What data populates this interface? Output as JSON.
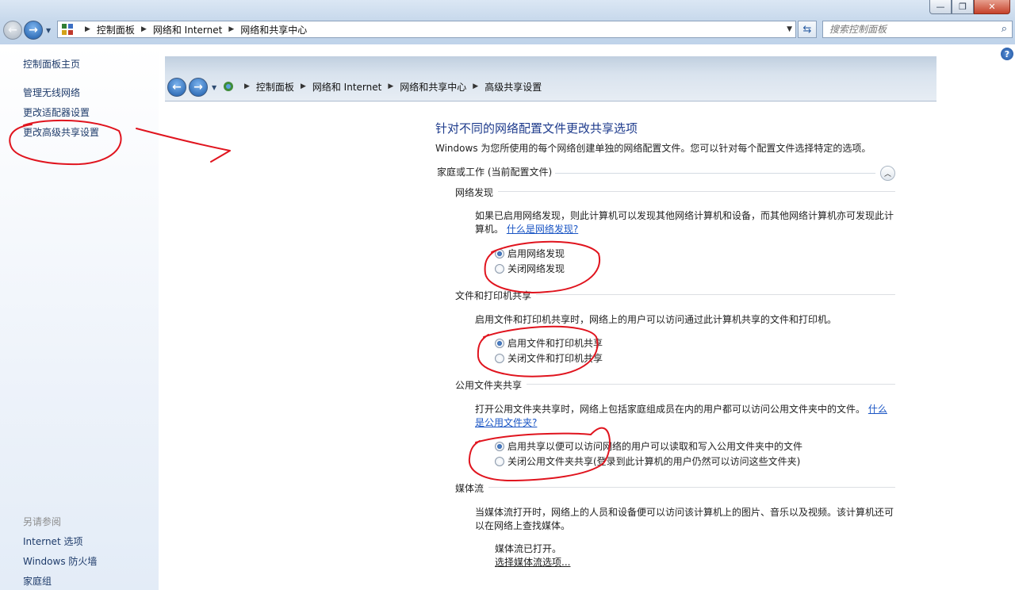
{
  "window": {
    "min_glyph": "—",
    "max_glyph": "❐",
    "close_glyph": "✕"
  },
  "outer_nav": {
    "back_glyph": "←",
    "forward_glyph": "→",
    "breadcrumbs": [
      "控制面板",
      "网络和 Internet",
      "网络和共享中心"
    ],
    "search_placeholder": "搜索控制面板"
  },
  "left_pane": {
    "home": "控制面板主页",
    "tasks": [
      "管理无线网络",
      "更改适配器设置",
      "更改高级共享设置"
    ],
    "see_also_title": "另请参阅",
    "see_also": [
      "Internet 选项",
      "Windows 防火墙",
      "家庭组"
    ]
  },
  "inner_nav": {
    "breadcrumbs": [
      "控制面板",
      "网络和 Internet",
      "网络和共享中心",
      "高级共享设置"
    ]
  },
  "main": {
    "title": "针对不同的网络配置文件更改共享选项",
    "intro": "Windows 为您所使用的每个网络创建单独的网络配置文件。您可以针对每个配置文件选择特定的选项。",
    "profile_label": "家庭或工作 (当前配置文件)",
    "sections": {
      "discovery": {
        "title": "网络发现",
        "desc": "如果已启用网络发现，则此计算机可以发现其他网络计算机和设备，而其他网络计算机亦可发现此计算机。",
        "link": "什么是网络发现?",
        "options": [
          "启用网络发现",
          "关闭网络发现"
        ],
        "selected": 0
      },
      "file_print": {
        "title": "文件和打印机共享",
        "desc": "启用文件和打印机共享时，网络上的用户可以访问通过此计算机共享的文件和打印机。",
        "options": [
          "启用文件和打印机共享",
          "关闭文件和打印机共享"
        ],
        "selected": 0
      },
      "public_folder": {
        "title": "公用文件夹共享",
        "desc": "打开公用文件夹共享时，网络上包括家庭组成员在内的用户都可以访问公用文件夹中的文件。",
        "link": "什么是公用文件夹?",
        "options": [
          "启用共享以便可以访问网络的用户可以读取和写入公用文件夹中的文件",
          "关闭公用文件夹共享(登录到此计算机的用户仍然可以访问这些文件夹)"
        ],
        "selected": 0
      },
      "media": {
        "title": "媒体流",
        "desc": "当媒体流打开时，网络上的人员和设备便可以访问该计算机上的图片、音乐以及视频。该计算机还可以在网络上查找媒体。",
        "status": "媒体流已打开。",
        "link": "选择媒体流选项..."
      }
    }
  },
  "annotation_color": "#e0141e"
}
